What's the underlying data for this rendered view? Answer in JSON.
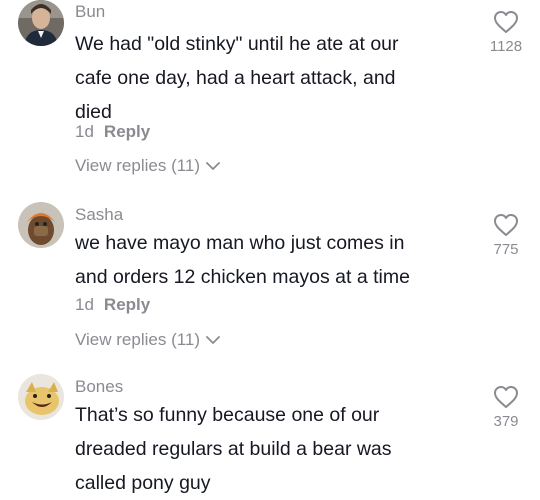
{
  "comments": [
    {
      "username": "Bun",
      "lines": [
        "We had \"old stinky\" until he ate at our",
        "cafe one day, had a heart attack, and",
        "died"
      ],
      "time": "1d",
      "reply_label": "Reply",
      "view_replies": "View replies (11)",
      "likes": "1128",
      "avatar_icon": "profile-photo-icon"
    },
    {
      "username": "Sasha",
      "lines": [
        "we have mayo man who just comes in",
        "and orders 12 chicken mayos at a time"
      ],
      "time": "1d",
      "reply_label": "Reply",
      "view_replies": "View replies (11)",
      "likes": "775",
      "avatar_icon": "profile-photo-icon"
    },
    {
      "username": "Bones",
      "lines": [
        "That’s so funny because one of our",
        "dreaded regulars at build a bear was",
        "called pony guy"
      ],
      "likes": "379",
      "avatar_icon": "profile-photo-icon"
    }
  ],
  "colors": {
    "text": "#161823",
    "muted": "#8a8b91"
  }
}
